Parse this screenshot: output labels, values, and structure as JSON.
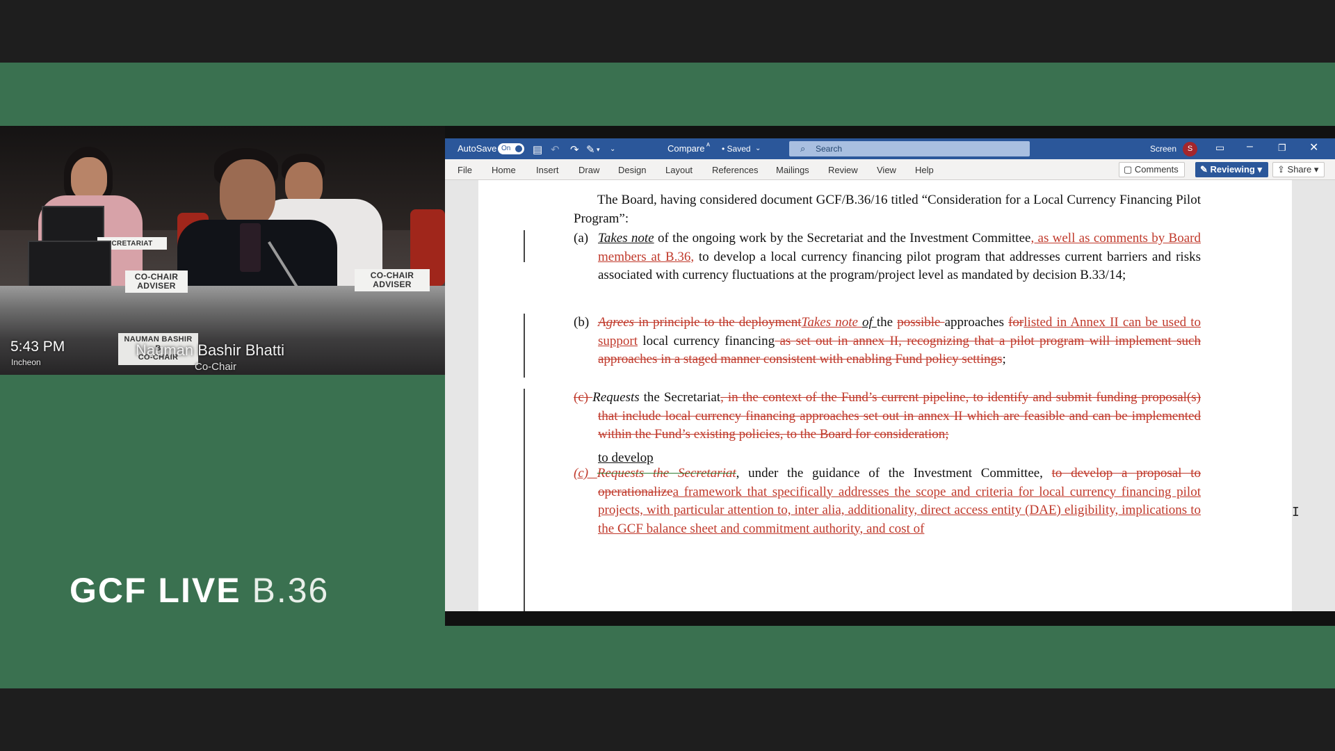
{
  "video": {
    "time": "5:43 PM",
    "location": "Incheon",
    "speaker_name": "Nauman Bashir Bhatti",
    "speaker_role": "Co-Chair",
    "placards": {
      "secretariat": "CRETARIAT",
      "adviser_left": "CO-CHAIR\nADVISER",
      "adviser_right": "CO-CHAIR\nADVISER",
      "speaker_card": "NAUMAN BASHIR\nB\nCO-CHAIR"
    }
  },
  "brand": {
    "bold": "GCF LIVE",
    "light": "B.36"
  },
  "word": {
    "autosave_label": "AutoSave",
    "autosave_state": "On",
    "compare_label": "Compare",
    "saved_label": "• Saved",
    "search_placeholder": "Search",
    "screen_label": "Screen",
    "user_initial": "S",
    "tabs": [
      "File",
      "Home",
      "Insert",
      "Draw",
      "Design",
      "Layout",
      "References",
      "Mailings",
      "Review",
      "View",
      "Help"
    ],
    "comments_label": "Comments",
    "reviewing_label": "Reviewing",
    "share_label": "Share"
  },
  "document": {
    "intro": "The Board, having considered document GCF/B.36/16 titled “Consideration for a Local Currency Financing Pilot Program”:",
    "a_label": "(a)",
    "a_takes": "Takes note",
    "a_text1": " of the ongoing work by the Secretariat and the Investment Committee",
    "a_ins": ", as well as comments by Board members at B.36,",
    "a_text2": " to develop a local currency financing pilot program that addresses current barriers and risks associated with currency fluctuations at the program/project level as mandated by decision B.33/14;",
    "b_label": "(b)",
    "b_agrees": "Agrees",
    "b_del1": " in principle to the deployment",
    "b_ins_takes": "Takes note ",
    "b_of": "of ",
    "b_the": "the ",
    "b_del_possible": "possible ",
    "b_approaches": "approaches ",
    "b_del_for": "for",
    "b_ins1": "listed in Annex II can be used to support",
    "b_text_lcf": " local currency financing",
    "b_del2": " as set out in annex II, recognizing that a pilot program will implement such approaches in a staged manner consistent with enabling Fund policy settings",
    "b_end": ";",
    "c1_label": "(c) ",
    "c1_requests": "Requests",
    "c1_text": " the Secretariat",
    "c1_del": ", in the context of the Fund’s current pipeline, to identify and submit funding proposal(s) that include local currency financing approaches set out in annex II which are feasible and can be implemented within the Fund’s existing policies, to the Board for consideration;",
    "c_moved": " to develop",
    "c2_label": "(c) ",
    "c2_del_requests": "Requests the Secretariat",
    "c2_text": ", under the guidance of the Investment Committee, ",
    "c2_del2": "to develop a proposal to operationalize",
    "c2_ins": "a framework that specifically addresses the scope and criteria for local currency financing pilot projects, with particular attention to, inter alia, additionality, direct access entity (DAE) eligibility, implications to the GCF balance sheet and commitment authority, and cost of"
  }
}
